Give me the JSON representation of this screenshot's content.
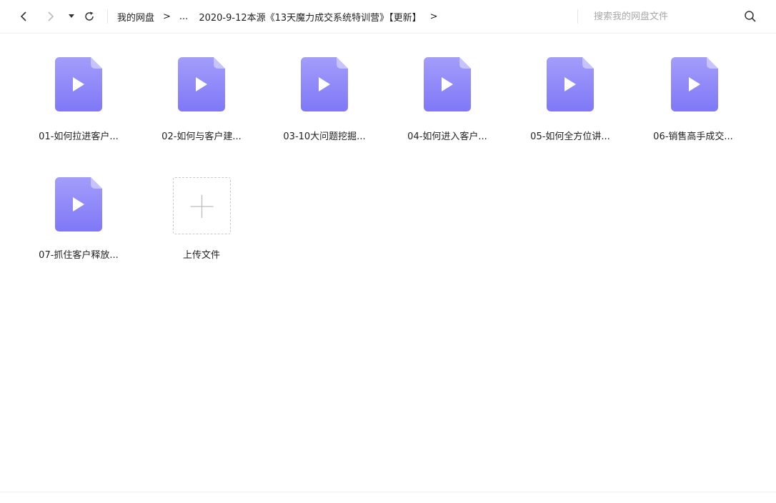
{
  "toolbar": {
    "breadcrumbs": {
      "root": "我的网盘",
      "sep1": ">",
      "ellipsis": "...",
      "current": "2020-9-12本源《13天魔力成交系统特训营》【更新】",
      "sep2": ">"
    },
    "search": {
      "placeholder": "搜索我的网盘文件"
    }
  },
  "files": [
    {
      "name": "01-如何拉进客户...",
      "icon": "video-file-icon"
    },
    {
      "name": "02-如何与客户建...",
      "icon": "video-file-icon"
    },
    {
      "name": "03-10大问题挖掘...",
      "icon": "video-file-icon"
    },
    {
      "name": "04-如何进入客户...",
      "icon": "video-file-icon"
    },
    {
      "name": "05-如何全方位讲...",
      "icon": "video-file-icon"
    },
    {
      "name": "06-销售高手成交...",
      "icon": "video-file-icon"
    },
    {
      "name": "07-抓住客户释放...",
      "icon": "video-file-icon"
    }
  ],
  "upload": {
    "label": "上传文件",
    "icon": "plus-icon"
  },
  "colors": {
    "icon_top": "#a39dfb",
    "icon_bottom": "#7f78f7",
    "accent": "#8a84f9"
  }
}
